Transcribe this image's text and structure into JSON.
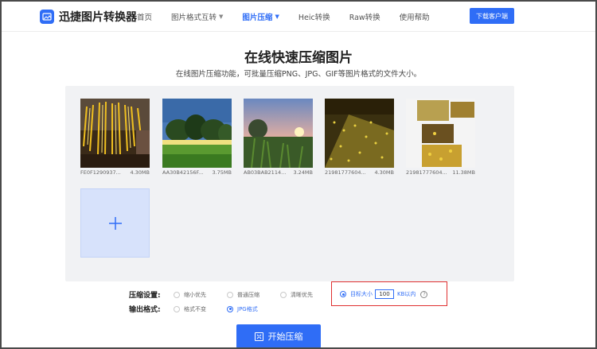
{
  "header": {
    "logo_text": "迅捷图片转换器",
    "nav": [
      {
        "label": "首页",
        "dropdown": false,
        "active": false
      },
      {
        "label": "图片格式互转",
        "dropdown": true,
        "active": false
      },
      {
        "label": "图片压缩",
        "dropdown": true,
        "active": true
      },
      {
        "label": "Heic转换",
        "dropdown": false,
        "active": false
      },
      {
        "label": "Raw转换",
        "dropdown": false,
        "active": false
      },
      {
        "label": "使用帮助",
        "dropdown": false,
        "active": false
      }
    ],
    "download_label": "下载客户端"
  },
  "main": {
    "title": "在线快速压缩图片",
    "subtitle": "在线图片压缩功能，可批量压缩PNG、JPG、GIF等图片格式的文件大小。"
  },
  "images": [
    {
      "name": "FE0F1290937...",
      "size": "4.30MB"
    },
    {
      "name": "AA30B42156F...",
      "size": "3.75MB"
    },
    {
      "name": "AB03BAB2114...",
      "size": "3.24MB"
    },
    {
      "name": "21981777604...",
      "size": "4.30MB"
    },
    {
      "name": "21981777604...",
      "size": "11.38MB"
    }
  ],
  "add_icon": "plus-icon",
  "settings": {
    "compress_label": "压缩设置:",
    "compress_options": [
      "缩小优先",
      "普通压缩",
      "清晰优先"
    ],
    "target_label": "目标大小",
    "target_value": "100",
    "target_unit": "KB以内",
    "output_label": "输出格式:",
    "output_options": [
      "格式不变",
      "JPG格式"
    ],
    "output_selected": "JPG格式",
    "compress_selected": "目标大小"
  },
  "start_label": "开始压缩",
  "colors": {
    "accent": "#2f6df6",
    "highlight": "#e03030"
  }
}
